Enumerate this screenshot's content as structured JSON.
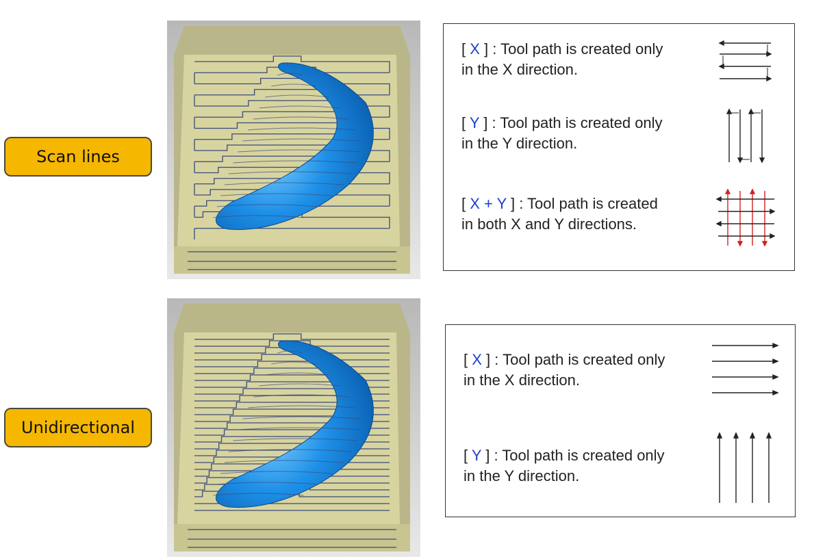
{
  "sections": [
    {
      "label": "Scan lines",
      "options": [
        {
          "tag": "X",
          "line1": ": Tool path is created only",
          "line2": "in the X direction.",
          "icon": "x-zigzag-arrows-icon"
        },
        {
          "tag": "Y",
          "line1": ": Tool path is created only",
          "line2": "in the Y direction.",
          "icon": "y-zigzag-arrows-icon"
        },
        {
          "tag": "X + Y",
          "line1": ": Tool path is created",
          "line2": "in both X and Y directions.",
          "icon": "xy-grid-arrows-icon"
        }
      ]
    },
    {
      "label": "Unidirectional",
      "options": [
        {
          "tag": "X",
          "line1": ": Tool path is created only",
          "line2": "in the X direction.",
          "icon": "x-parallel-arrows-icon"
        },
        {
          "tag": "Y",
          "line1": ": Tool path is created only",
          "line2": "in the Y direction.",
          "icon": "y-parallel-arrows-icon"
        }
      ]
    }
  ],
  "colors": {
    "badge": "#f5b700",
    "part": "#1e90e8",
    "stock": "#d8d4a0",
    "toolpath": "#3a4a7a",
    "tag": "#1a3fd0",
    "xy_red": "#d42020"
  }
}
